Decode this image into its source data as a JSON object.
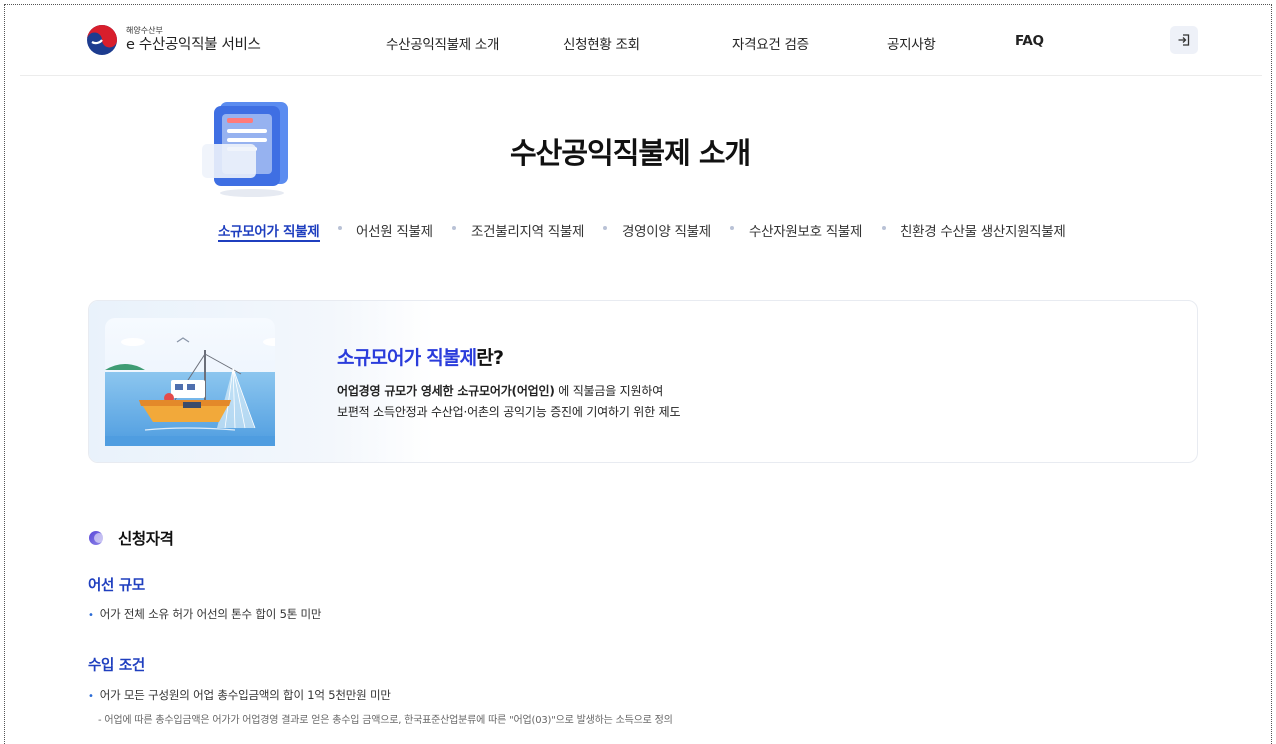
{
  "header": {
    "logo_small": "해양수산부",
    "logo_main": "e 수산공익직불 서비스",
    "nav": [
      "수산공익직불제 소개",
      "신청현황 조회",
      "자격요건 검증",
      "공지사항",
      "FAQ"
    ],
    "login_icon": "login-icon"
  },
  "page": {
    "title": "수산공익직불제 소개"
  },
  "tabs": [
    "소규모어가 직불제",
    "어선원 직불제",
    "조건불리지역 직불제",
    "경영이양 직불제",
    "수산자원보호 직불제",
    "친환경 수산물 생산지원직불제"
  ],
  "intro": {
    "title_highlight": "소규모어가 직불제",
    "title_rest": "란?",
    "desc_bold": "어업경영 규모가 영세한 소규모어가(어업인)",
    "desc_line1_rest": " 에 직불금을 지원하여",
    "desc_line2": "보편적 소득안정과 수산업·어촌의 공익기능 증진에 기여하기 위한 제도"
  },
  "eligibility": {
    "heading": "신청자격",
    "boat_title": "어선 규모",
    "boat_item": "어가 전체 소유 허가 어선의 톤수 합이 5톤 미만",
    "income_title": "수입 조건",
    "income_item": "어가 모든 구성원의 어업 총수입금액의 합이 1억 5천만원 미만",
    "income_note": "- 어업에 따른 총수입금액은 어가가 어업경영 결과로 얻은 총수입 금액으로, 한국표준산업분류에 따른 \"어업(03)\"으로 발생하는 소득으로 정의"
  },
  "colors": {
    "accent": "#1f3fbf",
    "highlight": "#2a3cdb"
  }
}
